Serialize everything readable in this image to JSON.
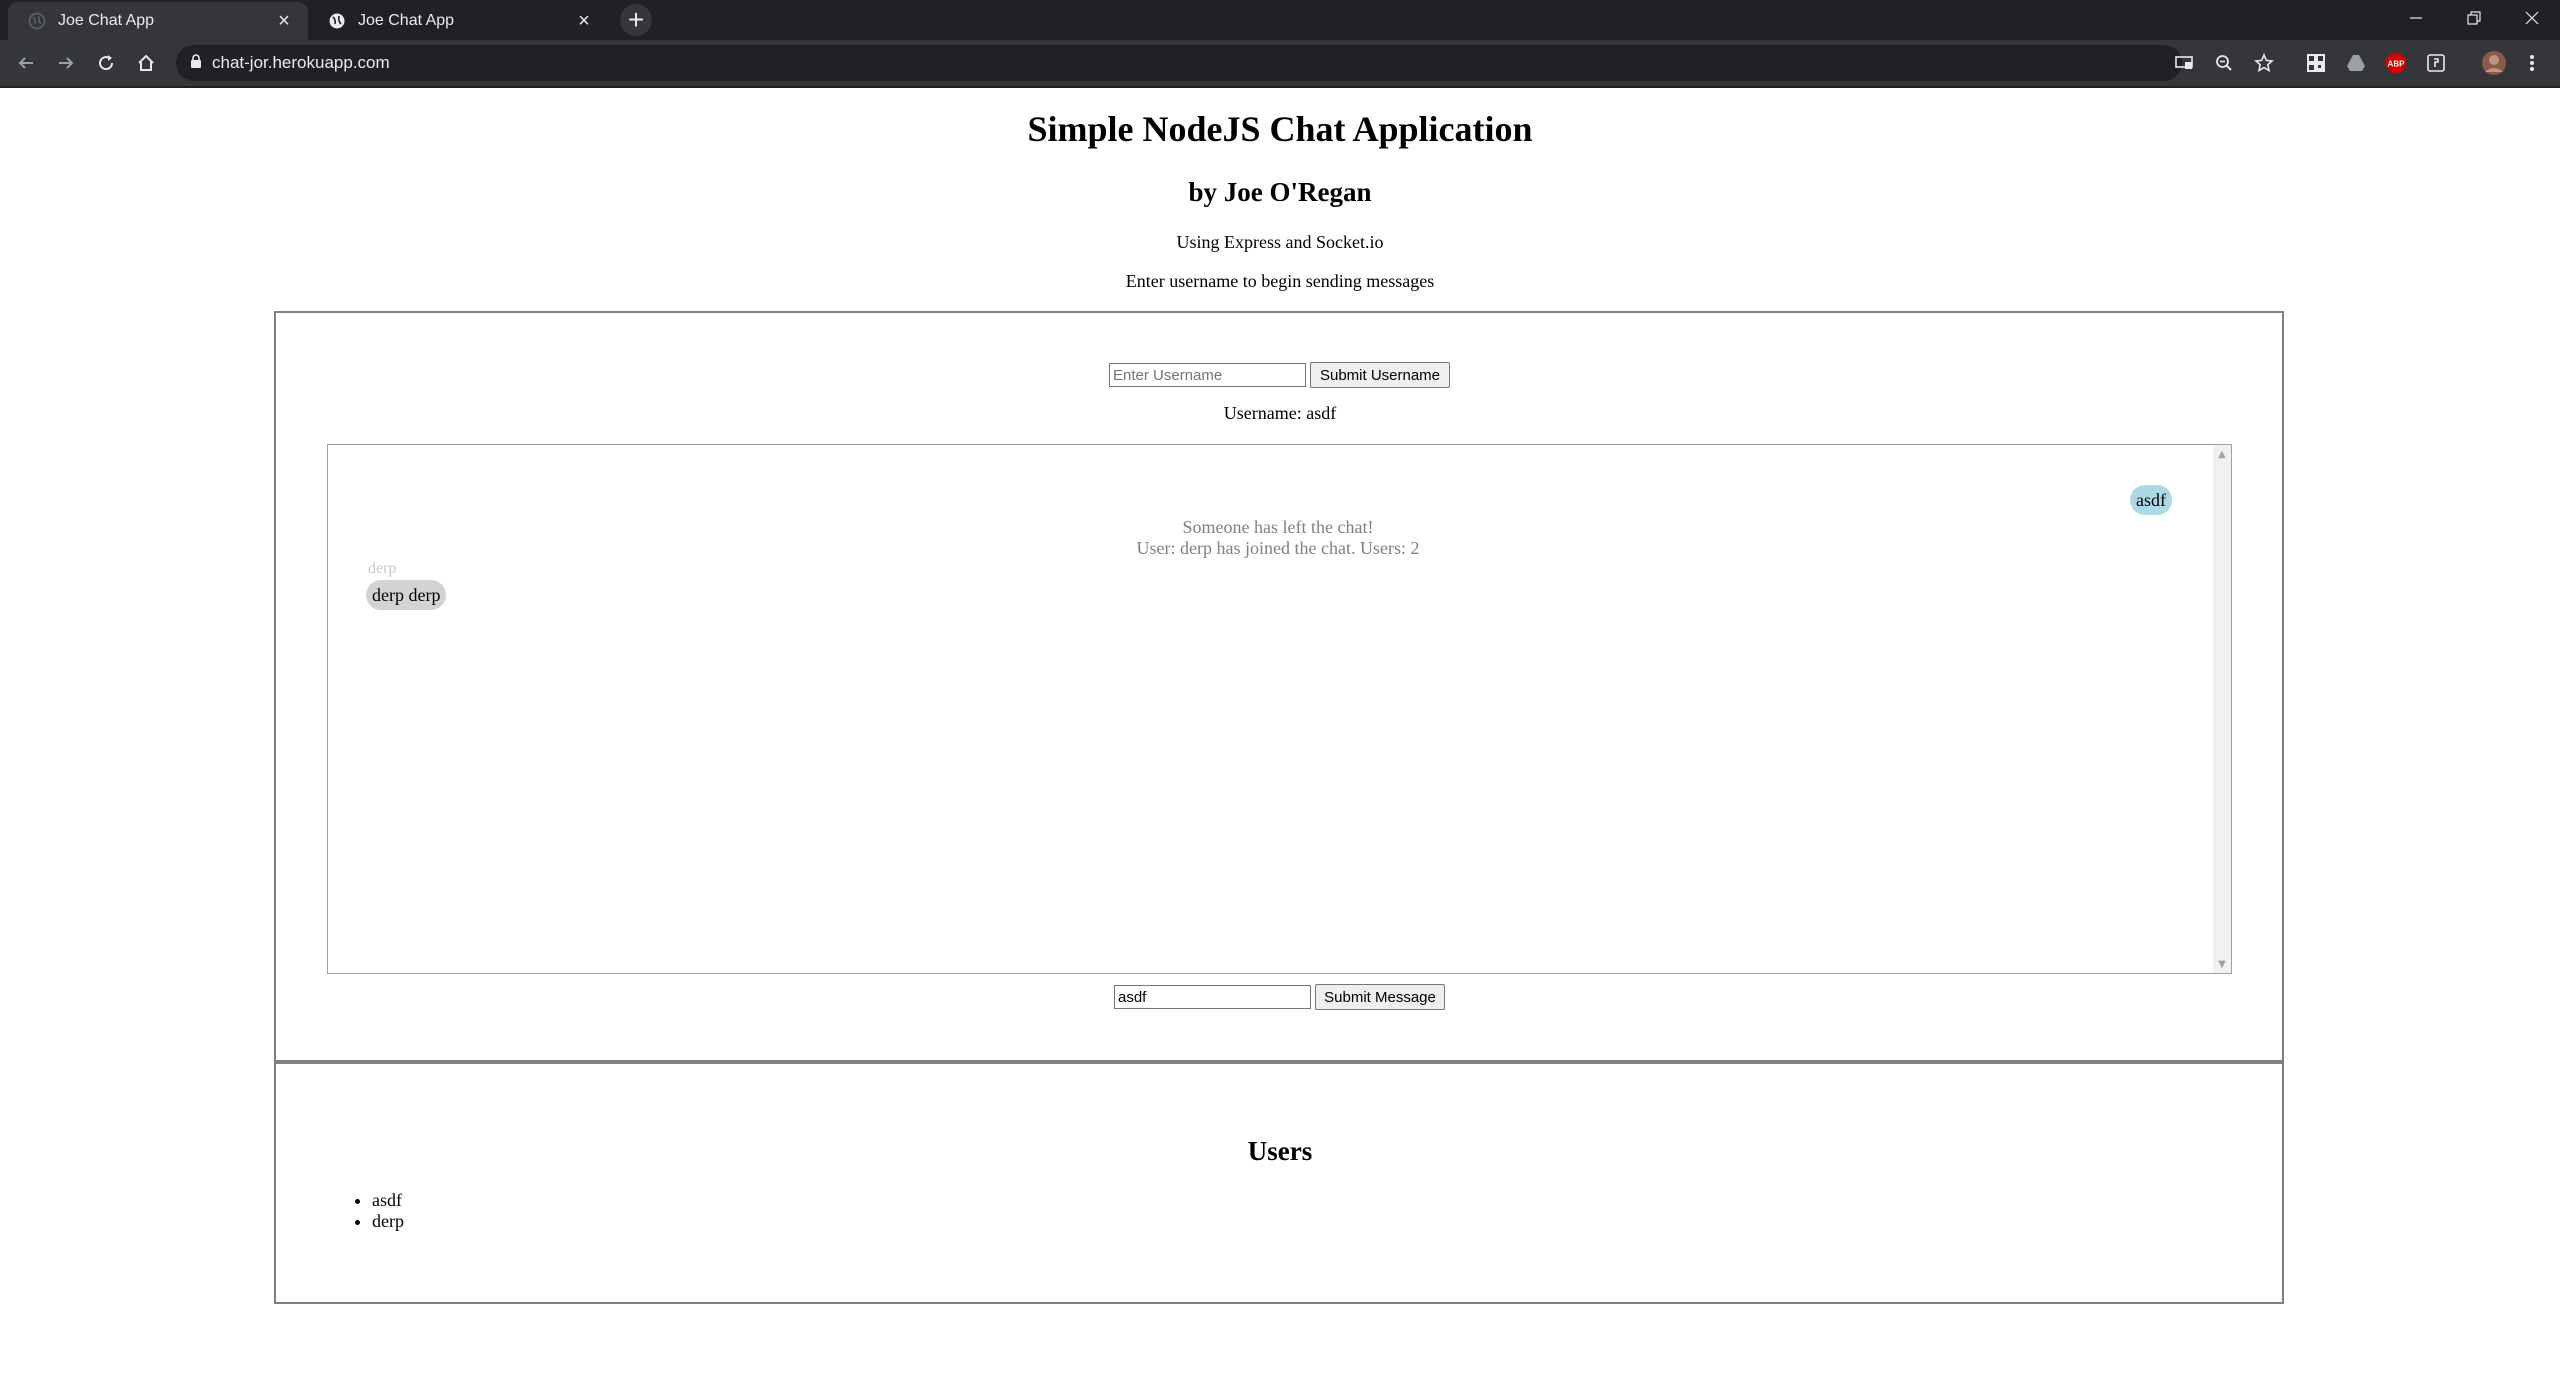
{
  "browser": {
    "tabs": [
      {
        "title": "Joe Chat App",
        "active": true
      },
      {
        "title": "Joe Chat App",
        "active": false
      }
    ],
    "new_tab_glyph": "+",
    "address": "chat-jor.herokuapp.com",
    "window_controls": [
      "minimize",
      "restore",
      "close"
    ],
    "toolbar_icons": [
      "cast-icon",
      "zoom-icon",
      "bookmark-star-icon",
      "qr-extension-icon",
      "drive-extension-icon",
      "adblock-plus-icon",
      "extension-icon",
      "profile-avatar",
      "menu-icon"
    ],
    "adblock_label": "ABP"
  },
  "page": {
    "title": "Simple NodeJS Chat Application",
    "subtitle": "by Joe O'Regan",
    "tech": "Using Express and Socket.io",
    "instruction": "Enter username to begin sending messages"
  },
  "username_form": {
    "placeholder": "Enter Username",
    "value": "",
    "submit_label": "Submit Username",
    "current_label": "Username: asdf"
  },
  "chat": {
    "messages": [
      {
        "type": "self",
        "text": "asdf"
      },
      {
        "type": "system",
        "text": "Someone has left the chat!"
      },
      {
        "type": "system",
        "text": "User: derp has joined the chat. Users: 2"
      },
      {
        "type": "other",
        "sender": "derp",
        "text": "derp derp"
      }
    ]
  },
  "message_form": {
    "value": "asdf",
    "submit_label": "Submit Message"
  },
  "users": {
    "title": "Users",
    "list": [
      "asdf",
      "derp"
    ]
  },
  "colors": {
    "self_bubble": "#add8e6",
    "other_bubble": "#d3d3d3",
    "system_text": "#808080",
    "frame_border": "#808080"
  }
}
